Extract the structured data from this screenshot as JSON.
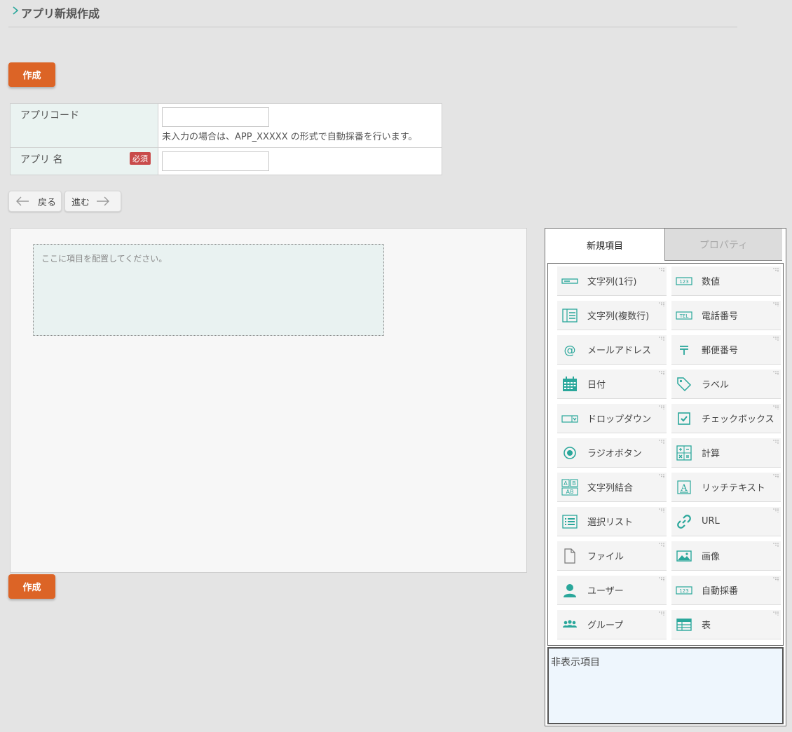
{
  "header": {
    "title": "アプリ新規作成"
  },
  "actions": {
    "create_label": "作成"
  },
  "form": {
    "app_code": {
      "label": "アプリコード",
      "value": "",
      "hint": "未入力の場合は、APP_XXXXX の形式で自動採番を行います。"
    },
    "app_name": {
      "label": "アプリ 名",
      "required": "必須",
      "value": ""
    }
  },
  "nav": {
    "back": "戻る",
    "forward": "進む"
  },
  "canvas": {
    "placeholder": "ここに項目を配置してください。"
  },
  "panel": {
    "tabs": [
      "新規項目",
      "プロパティ"
    ],
    "items": [
      {
        "label": "文字列(1行)",
        "icon": "text-single-line-icon"
      },
      {
        "label": "数値",
        "icon": "number-icon"
      },
      {
        "label": "文字列(複数行)",
        "icon": "text-multiline-icon"
      },
      {
        "label": "電話番号",
        "icon": "phone-icon"
      },
      {
        "label": "メールアドレス",
        "icon": "at-sign-icon"
      },
      {
        "label": "郵便番号",
        "icon": "postal-mark-icon"
      },
      {
        "label": "日付",
        "icon": "calendar-icon"
      },
      {
        "label": "ラベル",
        "icon": "tag-icon"
      },
      {
        "label": "ドロップダウン",
        "icon": "dropdown-icon"
      },
      {
        "label": "チェックボックス",
        "icon": "checkbox-icon"
      },
      {
        "label": "ラジオボタン",
        "icon": "radio-icon"
      },
      {
        "label": "計算",
        "icon": "calculator-icon"
      },
      {
        "label": "文字列結合",
        "icon": "string-concat-icon"
      },
      {
        "label": "リッチテキスト",
        "icon": "rich-text-icon"
      },
      {
        "label": "選択リスト",
        "icon": "list-icon"
      },
      {
        "label": "URL",
        "icon": "link-icon"
      },
      {
        "label": "ファイル",
        "icon": "file-icon"
      },
      {
        "label": "画像",
        "icon": "image-icon"
      },
      {
        "label": "ユーザー",
        "icon": "user-icon"
      },
      {
        "label": "自動採番",
        "icon": "auto-number-icon"
      },
      {
        "label": "グループ",
        "icon": "group-icon"
      },
      {
        "label": "表",
        "icon": "table-icon"
      }
    ],
    "hidden_label": "非表示項目"
  },
  "colors": {
    "accent": "#dc6426",
    "icon": "#2aa79b",
    "required": "#c94b4b"
  }
}
